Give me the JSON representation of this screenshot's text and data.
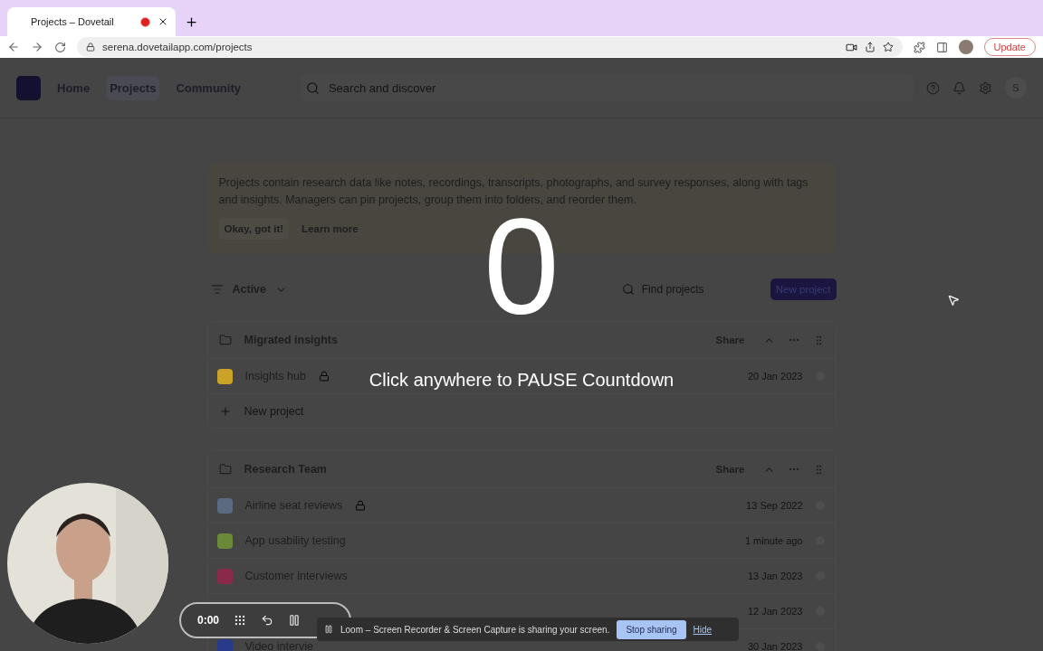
{
  "browser": {
    "tab": {
      "title": "Projects – Dovetail",
      "recording": true
    },
    "url": "serena.dovetailapp.com/projects",
    "update_label": "Update"
  },
  "nav": {
    "items": [
      {
        "label": "Home",
        "selected": false
      },
      {
        "label": "Projects",
        "selected": true
      },
      {
        "label": "Community",
        "selected": false
      }
    ],
    "search_placeholder": "Search and discover",
    "avatar": "S"
  },
  "banner": {
    "text": "Projects contain research data like notes, recordings, transcripts, photographs, and survey responses, along with tags and insights. Managers can pin projects, group them into folders, and reorder them.",
    "buttons": [
      "Okay, got it!",
      "Learn more"
    ]
  },
  "toolbar": {
    "filter": "Active",
    "search_placeholder": "Find projects",
    "new_button": "New project"
  },
  "folders": [
    {
      "name": "Migrated insights",
      "share_label": "Share",
      "expanded": true,
      "new_project": "New project",
      "projects": [
        {
          "name": "Insights hub",
          "locked": true,
          "date": "20 Jan 2023",
          "color": "#c9a227"
        }
      ]
    },
    {
      "name": "Research Team",
      "share_label": "Share",
      "expanded": true,
      "projects": [
        {
          "name": "Airline seat reviews",
          "locked": true,
          "date": "13 Sep 2022",
          "color": "#5b6a80"
        },
        {
          "name": "App usability testing",
          "locked": false,
          "date": "1 minute ago",
          "color": "#6a8a3a"
        },
        {
          "name": "Customer interviews",
          "locked": false,
          "date": "13 Jan 2023",
          "color": "#8a2a4a"
        },
        {
          "locked": false,
          "date": "12 Jan 2023"
        },
        {
          "name": "Video intervie",
          "locked": false,
          "date": "30 Jan 2023",
          "color": "#2a3a8a"
        }
      ]
    }
  ],
  "countdown": {
    "number": "0",
    "hint": "Click anywhere to PAUSE Countdown"
  },
  "recorder": {
    "time": "0:00"
  },
  "share_notice": {
    "text": "Loom – Screen Recorder & Screen Capture is sharing your screen.",
    "stop": "Stop sharing",
    "hide": "Hide"
  }
}
